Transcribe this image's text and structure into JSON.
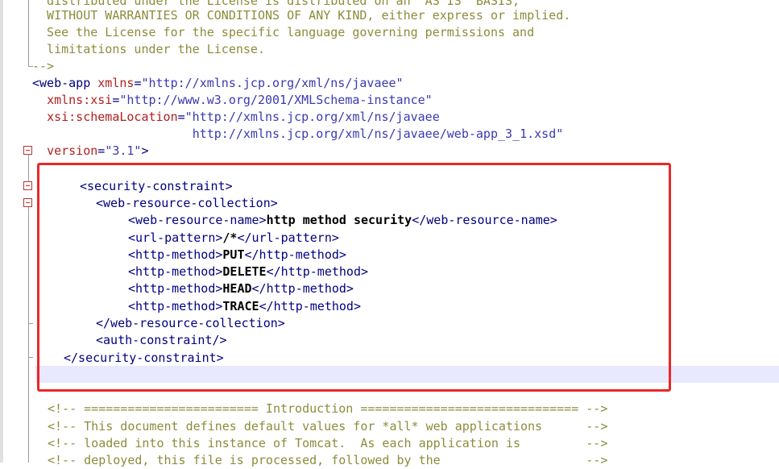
{
  "editor": {
    "license_lines": [
      "  distributed under the License is distributed on an \"AS IS\" BASIS,",
      "  WITHOUT WARRANTIES OR CONDITIONS OF ANY KIND, either express or implied.",
      "  See the License for the specific language governing permissions and",
      "  limitations under the License.",
      "-->"
    ],
    "root": {
      "open": "<web-app",
      "xmlns_attr": "xmlns",
      "xmlns_val": "\"http://xmlns.jcp.org/xml/ns/javaee\"",
      "xsi_attr": "xmlns:xsi",
      "xsi_val": "\"http://www.w3.org/2001/XMLSchema-instance\"",
      "schema_attr": "xsi:schemaLocation",
      "schema_val_1": "\"http://xmlns.jcp.org/xml/ns/javaee",
      "schema_val_2": "http://xmlns.jcp.org/xml/ns/javaee/web-app_3_1.xsd\"",
      "version_attr": "version",
      "version_val": "\"3.1\"",
      "close": ">"
    },
    "security": {
      "sc_open": "<security-constraint>",
      "wrc_open": "<web-resource-collection>",
      "wrn_open": "<web-resource-name>",
      "wrn_text": "http method security",
      "wrn_close": "</web-resource-name>",
      "up_open": "<url-pattern>",
      "up_text": "/*",
      "up_close": "</url-pattern>",
      "hm_open": "<http-method>",
      "hm_close": "</http-method>",
      "methods": [
        "PUT",
        "DELETE",
        "HEAD",
        "TRACE"
      ],
      "wrc_close": "</web-resource-collection>",
      "auth": "<auth-constraint/>",
      "sc_close": "</security-constraint>"
    },
    "comments": [
      "<!-- ======================== Introduction ============================== -->",
      "<!-- This document defines default values for *all* web applications      -->",
      "<!-- loaded into this instance of Tomcat.  As each application is         -->",
      "<!-- deployed, this file is processed, followed by the                    -->"
    ]
  }
}
